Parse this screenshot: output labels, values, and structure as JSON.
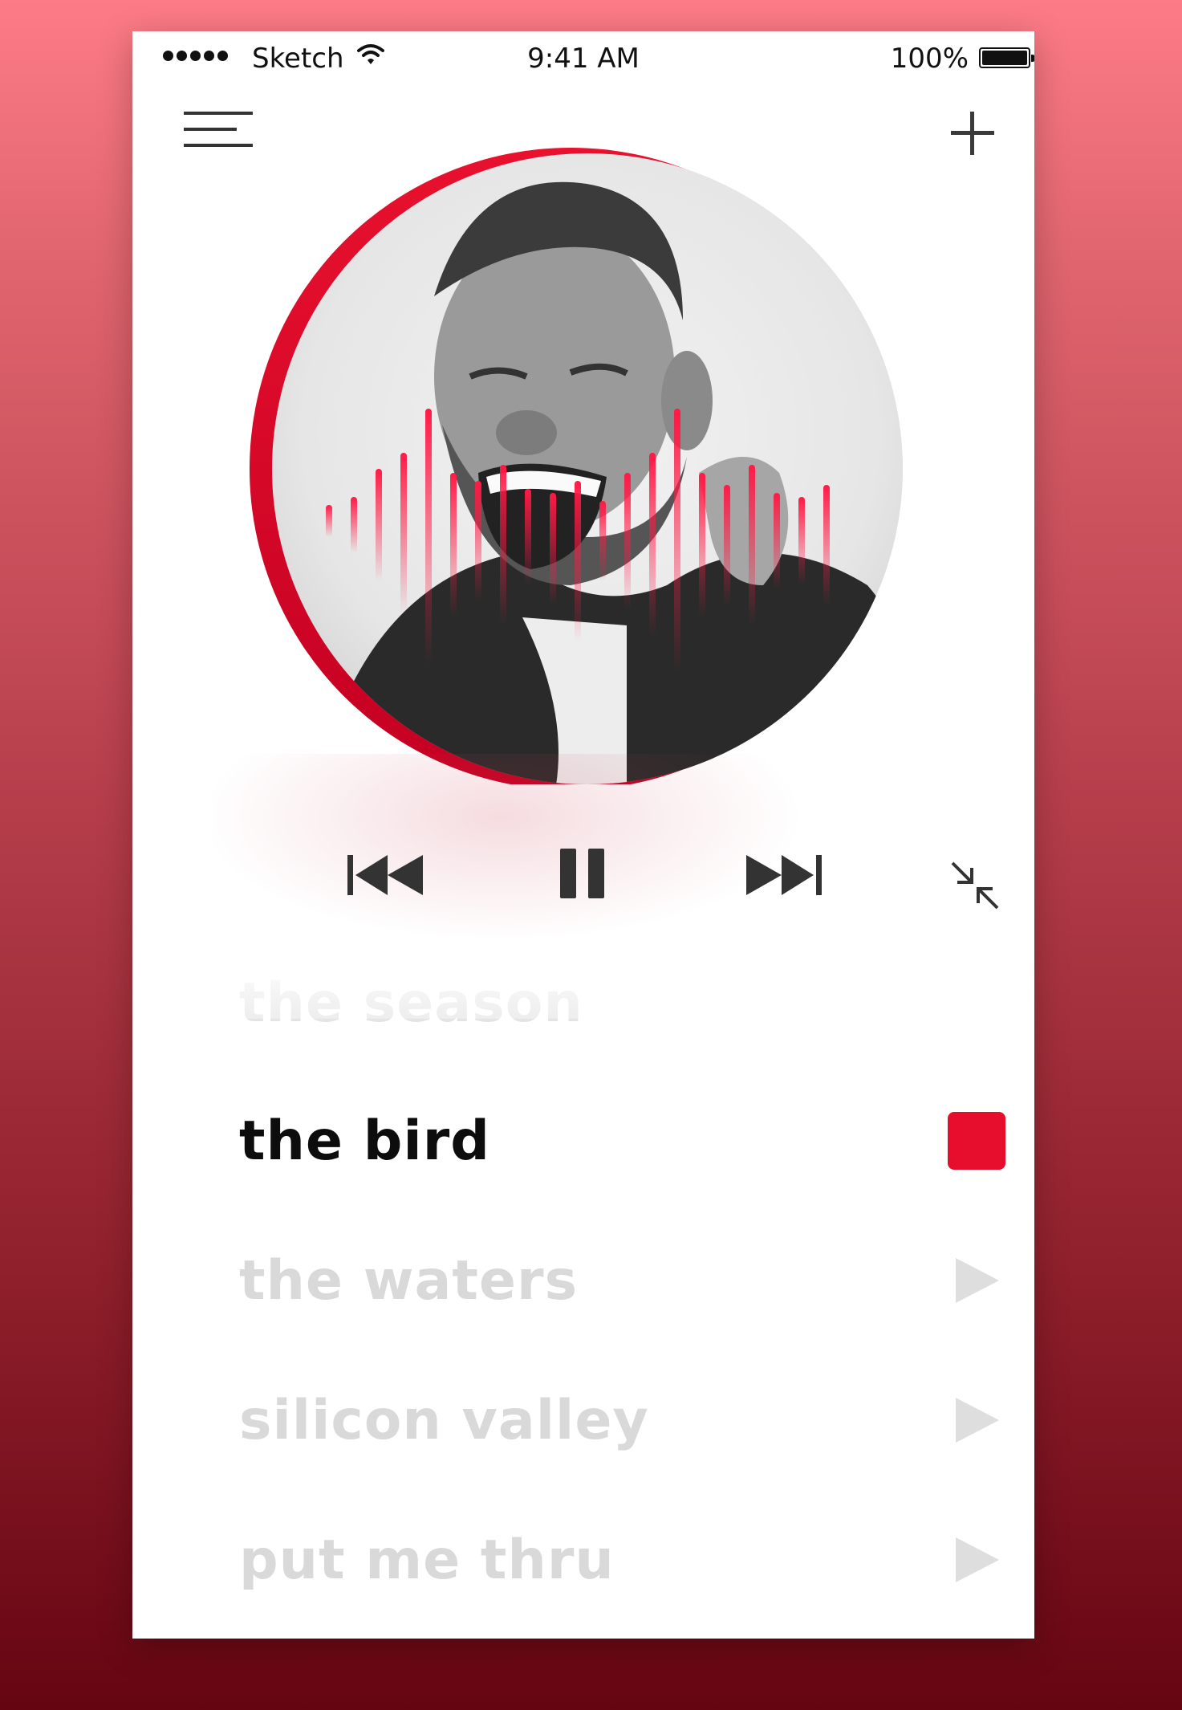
{
  "status_bar": {
    "carrier": "Sketch",
    "time": "9:41 AM",
    "battery": "100%"
  },
  "header": {
    "menu_icon": "hamburger-icon",
    "add_icon": "plus-icon"
  },
  "player": {
    "state": "playing",
    "controls": [
      "previous-icon",
      "pause-icon",
      "next-icon"
    ],
    "collapse_icon": "collapse-icon",
    "accent_color": "#e60e2c"
  },
  "tracks": [
    {
      "title": "the season",
      "state": "previous"
    },
    {
      "title": "the bird",
      "state": "playing"
    },
    {
      "title": "the waters",
      "state": "queued"
    },
    {
      "title": "silicon valley",
      "state": "queued"
    },
    {
      "title": "put me thru",
      "state": "queued"
    }
  ]
}
